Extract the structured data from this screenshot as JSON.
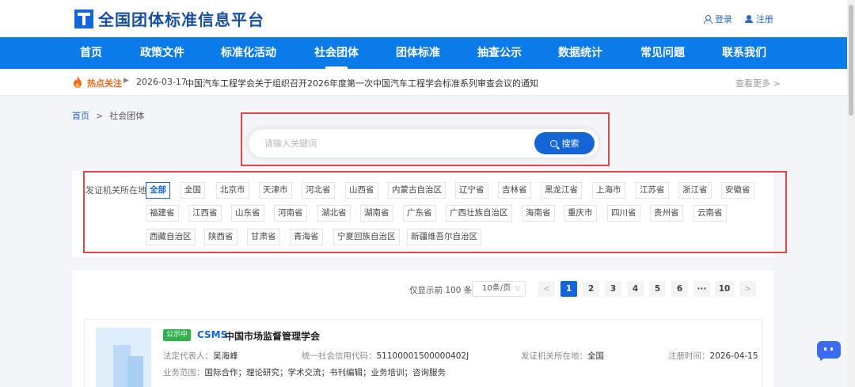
{
  "header": {
    "site_title": "全国团体标准信息平台",
    "login": "登录",
    "register": "注册"
  },
  "nav": {
    "items": [
      "首页",
      "政策文件",
      "标准化活动",
      "社会团体",
      "团体标准",
      "抽查公示",
      "数据统计",
      "常见问题",
      "联系我们"
    ],
    "active": "社会团体"
  },
  "notice": {
    "label": "热点关注",
    "date": "2026-03-17",
    "text": "中国汽车工程学会关于组织召开2026年度第一次中国汽车工程学会标准系列审查会议的通知",
    "more": "查看更多 >"
  },
  "breadcrumb": {
    "home": "首页",
    "separator": ">",
    "current": "社会团体"
  },
  "search": {
    "placeholder": "请输入关键词",
    "value": "",
    "button": "搜索"
  },
  "filter": {
    "label": "发证机关所在地",
    "selected": "全部",
    "options": [
      "全部",
      "全国",
      "北京市",
      "天津市",
      "河北省",
      "山西省",
      "内蒙古自治区",
      "辽宁省",
      "吉林省",
      "黑龙江省",
      "上海市",
      "江苏省",
      "浙江省",
      "安徽省",
      "福建省",
      "江西省",
      "山东省",
      "河南省",
      "湖北省",
      "湖南省",
      "广东省",
      "广西壮族自治区",
      "海南省",
      "重庆市",
      "四川省",
      "贵州省",
      "云南省",
      "西藏自治区",
      "陕西省",
      "甘肃省",
      "青海省",
      "宁夏回族自治区",
      "新疆维吾尔自治区"
    ]
  },
  "pagination": {
    "info": "仅显示前 100 条",
    "page_size": "10条/页",
    "prev": "<",
    "next": ">",
    "pages": [
      "1",
      "2",
      "3",
      "4",
      "5",
      "6",
      "···",
      "10"
    ],
    "current": "1"
  },
  "results": [
    {
      "status": "公示中",
      "abbr": "CSMS",
      "name": "中国市场监督管理学会",
      "rep_label": "法定代表人：",
      "rep": "吴海峰",
      "credit_label": "统一社会信用代码：",
      "credit": "51100001500000402J",
      "authority_label": "发证机关所在地：",
      "authority": "全国",
      "date_label": "注册时间：",
      "date": "2026-04-15",
      "scope_label": "业务范围：",
      "scope": "国际合作；理论研究；学术交流；书刊编辑；业务培训；咨询服务"
    }
  ],
  "colors": {
    "primary": "#1466d6",
    "nav_bg": "#0a7be8",
    "hot": "#f06a1c",
    "highlight": "#e04848",
    "status_green": "#33b24b"
  }
}
